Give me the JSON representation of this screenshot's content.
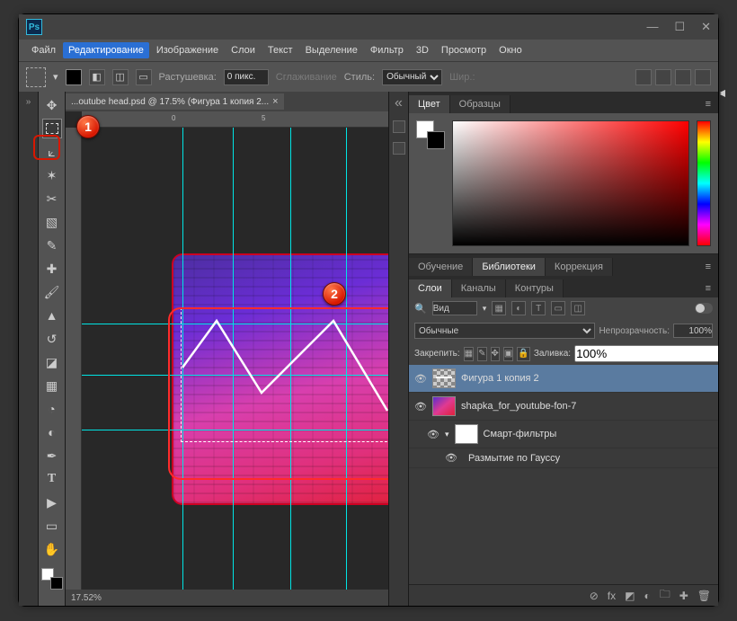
{
  "menubar": [
    "Файл",
    "Редактирование",
    "Изображение",
    "Слои",
    "Текст",
    "Выделение",
    "Фильтр",
    "3D",
    "Просмотр",
    "Окно"
  ],
  "active_menu": 1,
  "optionsbar": {
    "feather_label": "Растушевка:",
    "feather_value": "0 пикс.",
    "anti_alias_label": "Сглаживание",
    "style_label": "Стиль:",
    "style_value": "Обычный",
    "width_label": "Шир.:"
  },
  "document": {
    "tab_label": "...outube head.psd @ 17.5% (Фигура 1 копия 2... ",
    "zoom": "17.52%"
  },
  "annotations": {
    "one": "1",
    "two": "2"
  },
  "panels": {
    "color_tab": "Цвет",
    "swatches_tab": "Образцы",
    "learn_tab": "Обучение",
    "libraries_tab": "Библиотеки",
    "adjustments_tab": "Коррекция",
    "layers_tab": "Слои",
    "channels_tab": "Каналы",
    "paths_tab": "Контуры",
    "filter_placeholder": "Вид",
    "blend_mode": "Обычные",
    "opacity_label": "Непрозрачность:",
    "opacity_value": "100%",
    "lock_label": "Закрепить:",
    "fill_label": "Заливка:",
    "fill_value": "100%",
    "layers": [
      {
        "name": "Фигура 1 копия 2",
        "selected": true,
        "depth": 0,
        "thumb": "checker"
      },
      {
        "name": "shapka_for_youtube-fon-7",
        "selected": false,
        "depth": 0,
        "thumb": "img"
      },
      {
        "name": "Смарт-фильтры",
        "selected": false,
        "depth": 1,
        "thumb": "white"
      },
      {
        "name": "Размытие по Гауссу",
        "selected": false,
        "depth": 2,
        "thumb": "none"
      }
    ]
  }
}
